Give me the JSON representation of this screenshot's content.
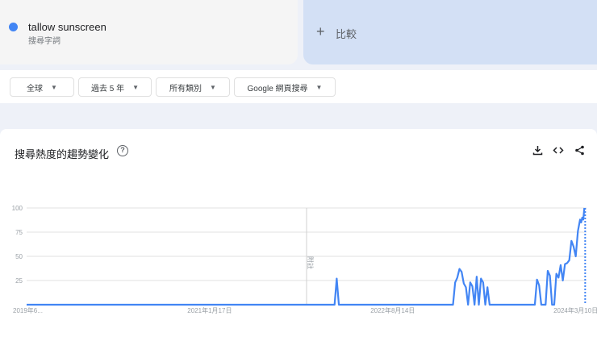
{
  "term": {
    "name": "tallow sunscreen",
    "subtitle": "搜尋字詞",
    "color": "#4285f4"
  },
  "compare": {
    "plus": "+",
    "label": "比較"
  },
  "filters": [
    {
      "label": "全球"
    },
    {
      "label": "過去 5 年"
    },
    {
      "label": "所有類別"
    },
    {
      "label": "Google 網頁搜尋"
    }
  ],
  "card": {
    "title": "搜尋熱度的趨勢變化",
    "help": "?",
    "icons": [
      "download-icon",
      "embed-icon",
      "share-icon"
    ]
  },
  "chart_data": {
    "type": "line",
    "title": "搜尋熱度的趨勢變化",
    "ylim": [
      0,
      100
    ],
    "yticks": [
      25,
      50,
      75,
      100
    ],
    "xticks": [
      {
        "week": 0,
        "label": "2019年6..."
      },
      {
        "week": 85,
        "label": "2021年1月17日"
      },
      {
        "week": 170,
        "label": "2022年8月14日"
      },
      {
        "week": 255,
        "label": "2024年3月10日"
      }
    ],
    "xmax": 260,
    "annotation": {
      "week": 130,
      "label": "附註"
    },
    "series": [
      {
        "name": "tallow sunscreen",
        "points": [
          [
            0,
            0
          ],
          [
            143,
            0
          ],
          [
            144,
            27
          ],
          [
            145,
            0
          ],
          [
            198,
            0
          ],
          [
            199,
            23
          ],
          [
            200,
            28
          ],
          [
            201,
            37
          ],
          [
            202,
            34
          ],
          [
            203,
            22
          ],
          [
            204,
            18
          ],
          [
            205,
            0
          ],
          [
            206,
            23
          ],
          [
            207,
            19
          ],
          [
            208,
            0
          ],
          [
            209,
            29
          ],
          [
            210,
            0
          ],
          [
            211,
            27
          ],
          [
            212,
            23
          ],
          [
            213,
            0
          ],
          [
            214,
            18
          ],
          [
            215,
            0
          ],
          [
            236,
            0
          ],
          [
            237,
            26
          ],
          [
            238,
            20
          ],
          [
            239,
            0
          ],
          [
            241,
            0
          ],
          [
            242,
            35
          ],
          [
            243,
            30
          ],
          [
            244,
            0
          ],
          [
            245,
            0
          ],
          [
            246,
            32
          ],
          [
            247,
            28
          ],
          [
            248,
            41
          ],
          [
            249,
            25
          ],
          [
            250,
            42
          ],
          [
            251,
            43
          ],
          [
            252,
            46
          ],
          [
            253,
            66
          ],
          [
            254,
            60
          ],
          [
            255,
            50
          ],
          [
            256,
            76
          ],
          [
            257,
            88
          ],
          [
            257.5,
            85
          ],
          [
            258,
            90
          ],
          [
            258.5,
            88
          ],
          [
            259,
            100
          ]
        ]
      }
    ],
    "partial": [
      [
        259,
        100
      ],
      [
        259.5,
        0
      ]
    ]
  }
}
